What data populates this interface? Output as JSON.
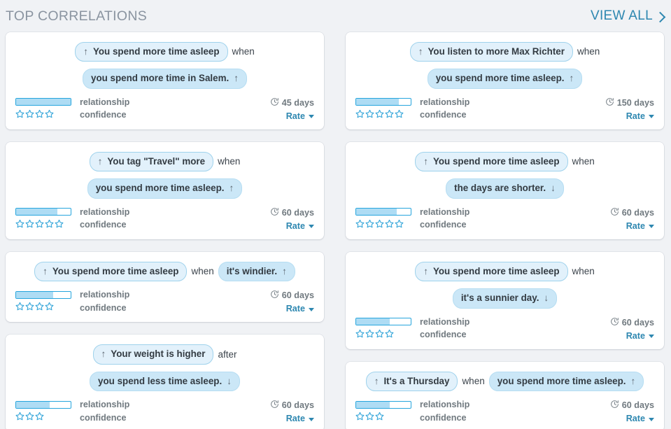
{
  "header": {
    "title": "TOP CORRELATIONS",
    "view_all_label": "VIEW ALL",
    "chevron_icon": "chevron-right-icon",
    "title_color": "#8a94a0",
    "accent_color": "#2d87b0"
  },
  "labels": {
    "relationship": "relationship",
    "confidence": "confidence",
    "rate": "Rate",
    "clock_icon": "clock-icon",
    "caret_icon": "caret-down-icon",
    "star_icon": "star-outline-icon",
    "arrow_up": "↑",
    "arrow_down": "↓"
  },
  "columns": [
    {
      "cards": [
        {
          "cause": "You spend more time asleep",
          "cause_arrow": "↑",
          "connector": "when",
          "effect": "you spend more time in Salem.",
          "effect_arrow": "↑",
          "relationship_pct": 100,
          "stars": 4,
          "duration": "45 days",
          "single_line": false
        },
        {
          "cause": "You tag \"Travel\" more",
          "cause_arrow": "↑",
          "connector": "when",
          "effect": "you spend more time asleep.",
          "effect_arrow": "↑",
          "relationship_pct": 75,
          "stars": 5,
          "duration": "60 days",
          "single_line": false
        },
        {
          "cause": "You spend more time asleep",
          "cause_arrow": "↑",
          "connector": "when",
          "effect": "it's windier.",
          "effect_arrow": "↑",
          "relationship_pct": 68,
          "stars": 4,
          "duration": "60 days",
          "single_line": true
        },
        {
          "cause": "Your weight is higher",
          "cause_arrow": "↑",
          "connector": "after",
          "effect": "you spend less time asleep.",
          "effect_arrow": "↓",
          "relationship_pct": 62,
          "stars": 3,
          "duration": "60 days",
          "single_line": false
        }
      ]
    },
    {
      "cards": [
        {
          "cause": "You listen to more Max Richter",
          "cause_arrow": "↑",
          "connector": "when",
          "effect": "you spend more time asleep.",
          "effect_arrow": "↑",
          "relationship_pct": 78,
          "stars": 5,
          "duration": "150 days",
          "single_line": false
        },
        {
          "cause": "You spend more time asleep",
          "cause_arrow": "↑",
          "connector": "when",
          "effect": "the days are shorter.",
          "effect_arrow": "↓",
          "relationship_pct": 74,
          "stars": 5,
          "duration": "60 days",
          "single_line": false
        },
        {
          "cause": "You spend more time asleep",
          "cause_arrow": "↑",
          "connector": "when",
          "effect": "it's a sunnier day.",
          "effect_arrow": "↓",
          "relationship_pct": 62,
          "stars": 4,
          "duration": "60 days",
          "single_line": false
        },
        {
          "cause": "It's a Thursday",
          "cause_arrow": "↑",
          "connector": "when",
          "effect": "you spend more time asleep.",
          "effect_arrow": "↑",
          "relationship_pct": 62,
          "stars": 3,
          "duration": "60 days",
          "single_line": true
        }
      ]
    }
  ]
}
